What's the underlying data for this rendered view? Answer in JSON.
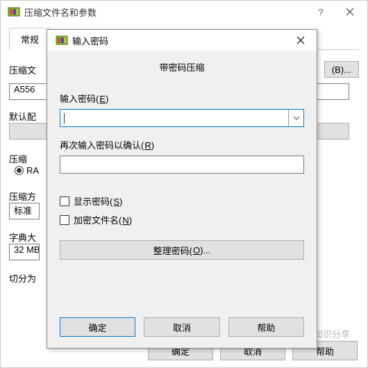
{
  "main": {
    "title": "压缩文件名和参数",
    "tab_general": "常规",
    "archive_label": "压缩文",
    "archive_value": "A556",
    "profile_label": "默认配",
    "format_label": "压缩",
    "format_option": "RA",
    "method_label": "压缩方",
    "method_value": "标准",
    "dict_label": "字典大",
    "dict_value": "32 MB",
    "split_label": "切分为",
    "browse_btn": "(B)...",
    "ok": "确定",
    "cancel": "取消",
    "help": "帮助"
  },
  "modal": {
    "title": "输入密码",
    "heading": "带密码压缩",
    "enter_pwd_prefix": "输入密码(",
    "enter_pwd_key": "E",
    "enter_pwd_suffix": ")",
    "reenter_pwd_prefix": "再次输入密码以确认(",
    "reenter_pwd_key": "R",
    "reenter_pwd_suffix": ")",
    "show_pwd_prefix": "显示密码(",
    "show_pwd_key": "S",
    "show_pwd_suffix": ")",
    "encrypt_fn_prefix": "加密文件名(",
    "encrypt_fn_key": "N",
    "encrypt_fn_suffix": ")",
    "organize_prefix": "整理密码(",
    "organize_key": "O",
    "organize_suffix": ")...",
    "ok": "确定",
    "cancel": "取消",
    "help": "帮助"
  },
  "watermark": "头条@生活百科知识分享"
}
